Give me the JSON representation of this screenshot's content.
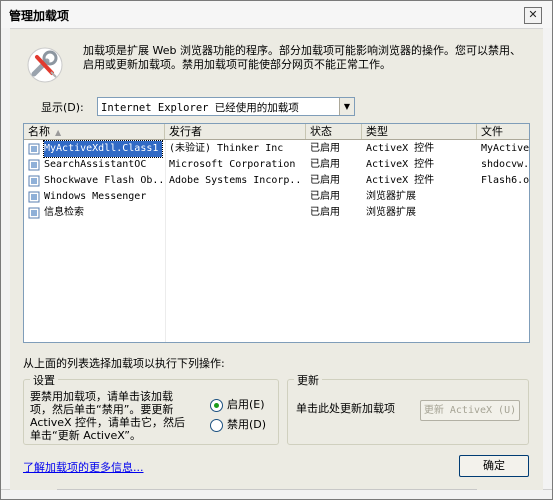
{
  "window": {
    "title": "管理加载项",
    "close_glyph": "✕"
  },
  "intro_text": "加载项是扩展 Web 浏览器功能的程序。部分加载项可能影响浏览器的操作。您可以禁用、启用或更新加载项。禁用加载项可能使部分网页不能正常工作。",
  "show": {
    "label": "显示(D):",
    "selected": "Internet Explorer 已经使用的加载项"
  },
  "list": {
    "columns": [
      "名称",
      "发行者",
      "状态",
      "类型",
      "文件"
    ],
    "rows": [
      {
        "name": "MyActiveXdll.Class1",
        "publisher": "(未验证) Thinker Inc",
        "status": "已启用",
        "type": "ActiveX 控件",
        "file": "MyActiveX",
        "selected": true
      },
      {
        "name": "SearchAssistantOC",
        "publisher": "Microsoft Corporation",
        "status": "已启用",
        "type": "ActiveX 控件",
        "file": "shdocvw.",
        "selected": false
      },
      {
        "name": "Shockwave Flash Ob...",
        "publisher": "Adobe Systems Incorp...",
        "status": "已启用",
        "type": "ActiveX 控件",
        "file": "Flash6.o",
        "selected": false
      },
      {
        "name": "Windows Messenger",
        "publisher": "",
        "status": "已启用",
        "type": "浏览器扩展",
        "file": "",
        "selected": false
      },
      {
        "name": "信息检索",
        "publisher": "",
        "status": "已启用",
        "type": "浏览器扩展",
        "file": "",
        "selected": false
      }
    ]
  },
  "action_label": "从上面的列表选择加载项以执行下列操作:",
  "settings": {
    "legend": "设置",
    "text": "要禁用加载项，请单击该加载项，然后单击“禁用”。要更新 ActiveX 控件，请单击它，然后单击“更新 ActiveX”。",
    "enable_label": "启用(E)",
    "disable_label": "禁用(D)"
  },
  "update": {
    "legend": "更新",
    "text": "单击此处更新加载项",
    "button": "更新 ActiveX (U)"
  },
  "more_link": "了解加载项的更多信息...",
  "ok_button": "确定",
  "colors": {
    "selection": "#316ac5",
    "link": "#0000ee",
    "radio_dot": "#1b9c1b"
  }
}
